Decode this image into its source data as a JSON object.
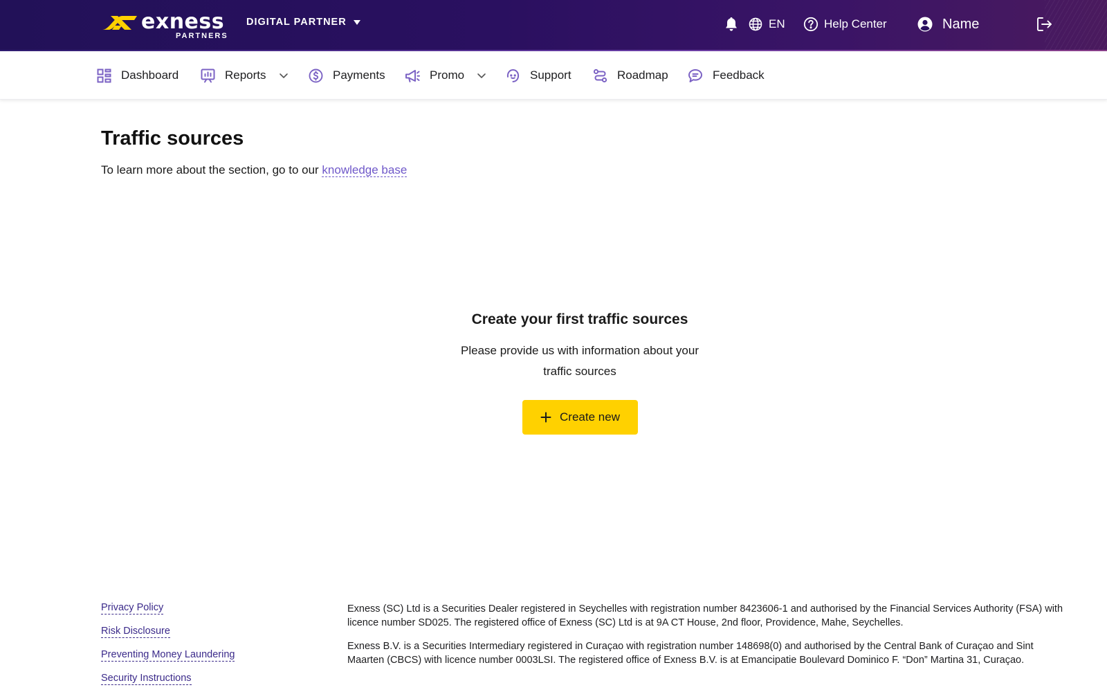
{
  "header": {
    "logo_word": "exness",
    "logo_sub": "PARTNERS",
    "partner_type": "DIGITAL PARTNER",
    "language": "EN",
    "help_center": "Help Center",
    "user_name": "Name"
  },
  "nav": {
    "items": [
      {
        "label": "Dashboard",
        "icon": "dashboard-icon"
      },
      {
        "label": "Reports",
        "icon": "reports-icon",
        "has_dropdown": true
      },
      {
        "label": "Payments",
        "icon": "dollar-icon"
      },
      {
        "label": "Promo",
        "icon": "megaphone-icon",
        "has_dropdown": true
      },
      {
        "label": "Support",
        "icon": "support-icon"
      },
      {
        "label": "Roadmap",
        "icon": "roadmap-icon"
      },
      {
        "label": "Feedback",
        "icon": "feedback-icon"
      }
    ]
  },
  "main": {
    "title": "Traffic sources",
    "intro_text": "To learn more about the section, go to our ",
    "intro_link": "knowledge base",
    "empty_title": "Create your first traffic sources",
    "empty_desc": "Please provide us with information about your traffic sources",
    "create_button": "Create new"
  },
  "footer": {
    "links": [
      "Privacy Policy",
      "Risk Disclosure",
      "Preventing Money Laundering",
      "Security Instructions"
    ],
    "legal": [
      "Exness (SC) Ltd is a Securities Dealer registered in Seychelles with registration number 8423606-1 and authorised by the Financial Services Authority (FSA) with licence number SD025. The registered office of Exness (SC) Ltd is at 9A CT House, 2nd floor, Providence, Mahe, Seychelles.",
      "Exness B.V. is a Securities Intermediary registered in Curaçao with registration number 148698(0) and authorised by the Central Bank of Curaçao and Sint Maarten (CBCS) with licence number 0003LSI. The registered office of Exness B.V. is at Emancipatie Boulevard Dominico F. “Don” Martina 31, Curaçao."
    ]
  },
  "colors": {
    "header_bg": "#221158",
    "nav_icon": "#7b62c4",
    "link": "#6f58c9",
    "primary_button": "#ffd100",
    "logo_accent": "#ffd100"
  }
}
